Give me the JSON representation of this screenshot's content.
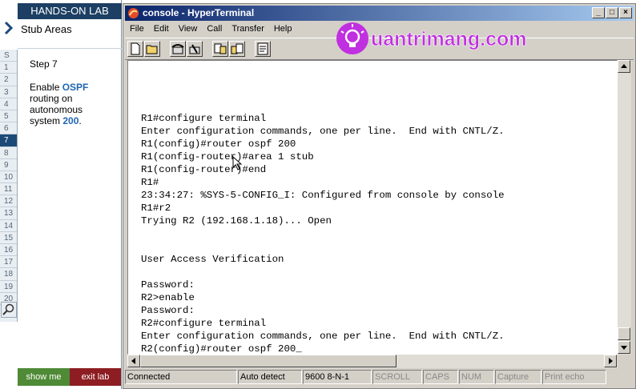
{
  "lab": {
    "header": "HANDS-ON LAB",
    "title": "Stub Areas",
    "step_label": "Step 7",
    "desc_prefix": "Enable ",
    "desc_kw1": "OSPF",
    "desc_middle": " routing on autonomous system ",
    "desc_kw2": "200",
    "desc_suffix": ".",
    "steps": [
      "S",
      "1",
      "2",
      "3",
      "4",
      "5",
      "6",
      "7",
      "8",
      "9",
      "10",
      "11",
      "12",
      "13",
      "14",
      "15",
      "16",
      "17",
      "18",
      "19",
      "20"
    ],
    "active_step": "7",
    "show_me": "show me",
    "exit_lab": "exit lab",
    "colors": {
      "header": "#1c3f63",
      "active": "#1c4a78",
      "show_me": "#4f8a36",
      "exit_lab": "#8d1d22",
      "keyword": "#1e66b2"
    }
  },
  "window": {
    "title": "console - HyperTerminal",
    "controls": [
      "_",
      "□",
      "×"
    ]
  },
  "menu": [
    "File",
    "Edit",
    "View",
    "Call",
    "Transfer",
    "Help"
  ],
  "toolbar_icons": [
    "new-document-icon",
    "open-folder-icon",
    "phone-icon",
    "disconnect-icon",
    "send-icon",
    "receive-icon",
    "properties-icon"
  ],
  "watermark": {
    "brand": "uantrimang.com",
    "color": "#c02fe0"
  },
  "terminal": {
    "lines": [
      "R1#configure terminal",
      "Enter configuration commands, one per line.  End with CNTL/Z.",
      "R1(config)#router ospf 200",
      "R1(config-router)#area 1 stub",
      "R1(config-router)#end",
      "R1#",
      "23:34:27: %SYS-5-CONFIG_I: Configured from console by console",
      "R1#r2",
      "Trying R2 (192.168.1.18)... Open",
      "",
      "",
      "User Access Verification",
      "",
      "Password:",
      "R2>enable",
      "Password:",
      "R2#configure terminal",
      "Enter configuration commands, one per line.  End with CNTL/Z.",
      "R2(config)#router ospf 200_"
    ]
  },
  "status": {
    "connected": "Connected",
    "detect": "Auto detect",
    "settings": "9600 8-N-1",
    "scroll": "SCROLL",
    "caps": "CAPS",
    "num": "NUM",
    "capture": "Capture",
    "print_echo": "Print echo"
  }
}
